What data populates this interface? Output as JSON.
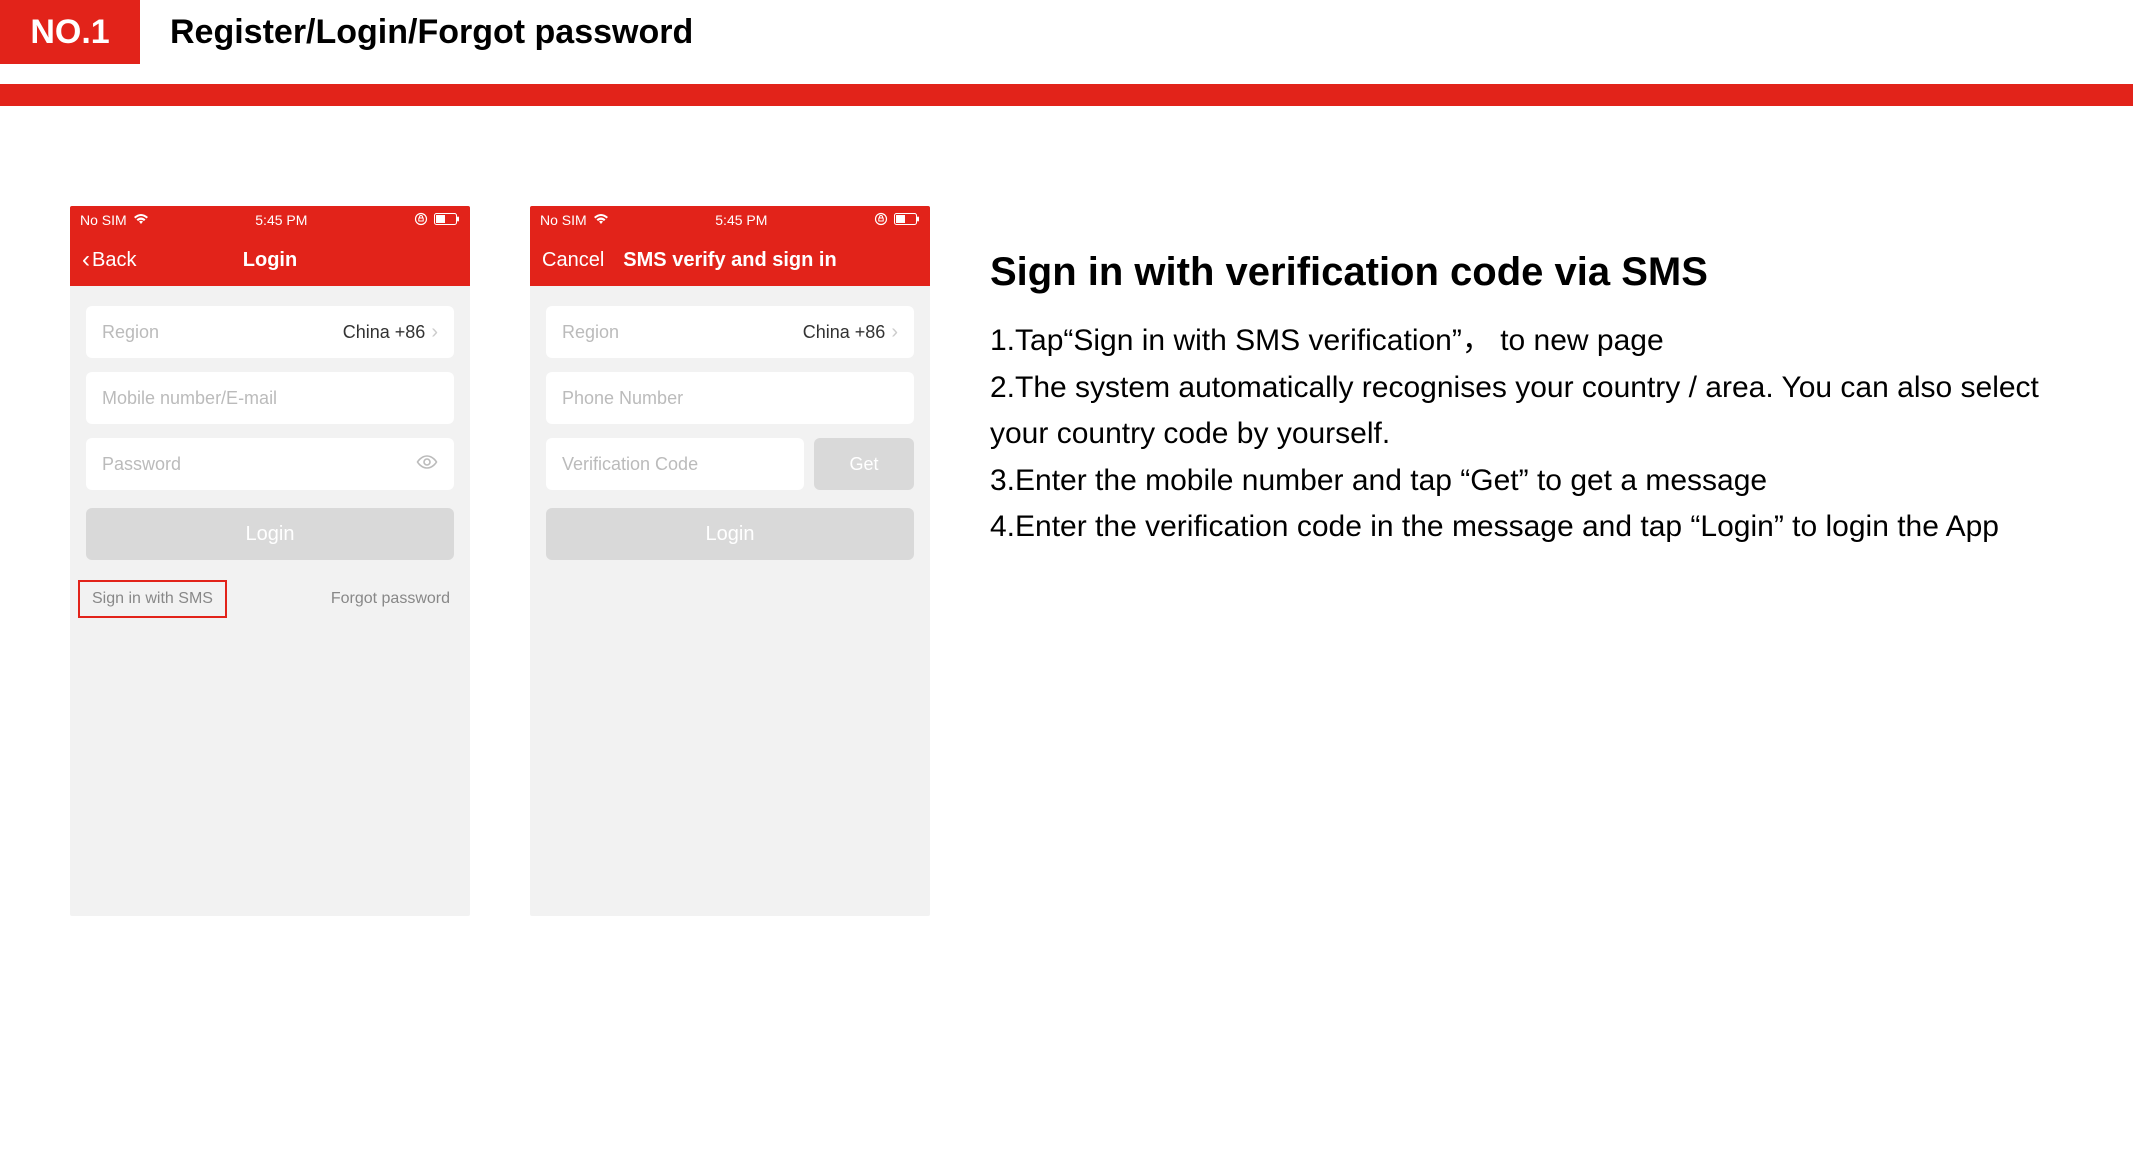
{
  "header": {
    "badge": "NO.1",
    "title": "Register/Login/Forgot password"
  },
  "phone1": {
    "status": {
      "carrier": "No SIM",
      "time": "5:45 PM"
    },
    "nav": {
      "back": "Back",
      "title": "Login"
    },
    "region": {
      "label": "Region",
      "value": "China +86"
    },
    "account_placeholder": "Mobile number/E-mail",
    "password_placeholder": "Password",
    "login_btn": "Login",
    "sms_link": "Sign in with SMS",
    "forgot_link": "Forgot password"
  },
  "phone2": {
    "status": {
      "carrier": "No SIM",
      "time": "5:45 PM"
    },
    "nav": {
      "cancel": "Cancel",
      "title": "SMS verify and sign in"
    },
    "region": {
      "label": "Region",
      "value": "China +86"
    },
    "phone_placeholder": "Phone Number",
    "code_placeholder": "Verification Code",
    "get_btn": "Get",
    "login_btn": "Login"
  },
  "instructions": {
    "title": "Sign in with verification code via SMS",
    "step1": "1.Tap“Sign in with SMS verification”， to new page",
    "step2": "2.The system automatically recognises your country / area. You can also select your country code by yourself.",
    "step3": "3.Enter the mobile number and tap “Get” to get a message",
    "step4": "4.Enter the verification code in the message and tap “Login” to login the App"
  }
}
